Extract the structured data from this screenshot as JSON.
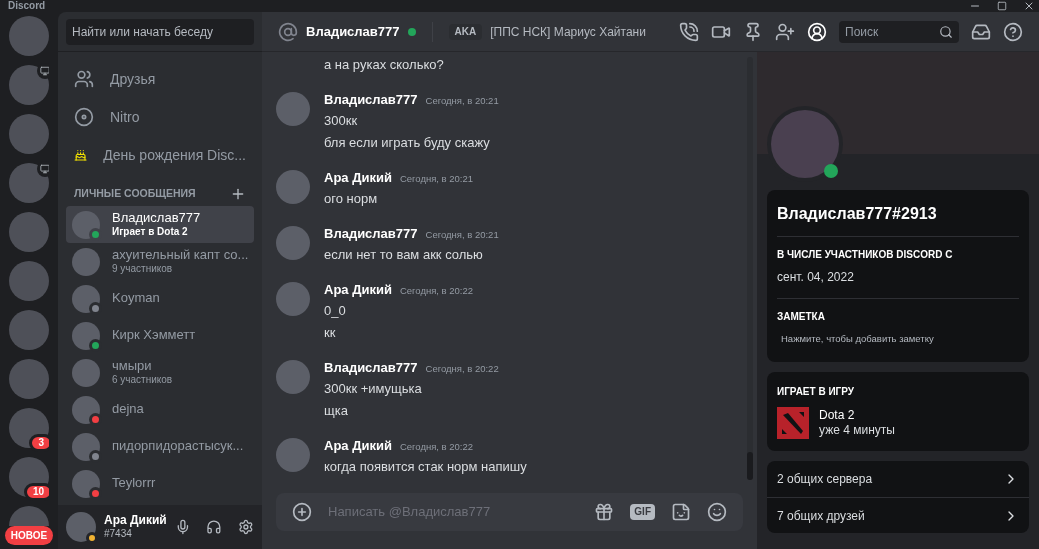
{
  "app_title": "Discord",
  "servers": [
    {
      "live": false
    },
    {
      "live": true
    },
    {
      "live": false
    },
    {
      "live": true
    },
    {
      "live": false
    },
    {
      "live": false
    },
    {
      "live": false
    },
    {
      "live": false
    },
    {
      "live": false,
      "badge": "3"
    },
    {
      "live": false,
      "badge": "10"
    },
    {
      "live": false
    }
  ],
  "new_badge": "НОВОЕ",
  "dm_search": {
    "placeholder": "Найти или начать беседу"
  },
  "nav": [
    {
      "kind": "friends",
      "label": "Друзья"
    },
    {
      "kind": "nitro",
      "label": "Nitro"
    },
    {
      "kind": "birthday",
      "label": "День рождения Disc..."
    }
  ],
  "dm_header": "ЛИЧНЫЕ СООБЩЕНИЯ",
  "dms": [
    {
      "name": "Владислав777",
      "sub": "Играет в Dota 2",
      "color": "#23a55a",
      "selected": true
    },
    {
      "name": "ахуительный капт со...",
      "sub": "9 участников",
      "selected": false
    },
    {
      "name": "Koyman",
      "color": "#80848e",
      "selected": false
    },
    {
      "name": "Кирк Хэмметт",
      "color": "#23a55a",
      "selected": false
    },
    {
      "name": "чмыри",
      "sub": "6 участников",
      "selected": false
    },
    {
      "name": "dejna",
      "color": "#f23f43",
      "selected": false
    },
    {
      "name": "пидорпидорастысук...",
      "color": "#80848e",
      "selected": false
    },
    {
      "name": "Teylorrr",
      "color": "#f23f43",
      "selected": false
    }
  ],
  "user": {
    "name": "Ара Дикий",
    "tag": "#7434",
    "color": "#f0b232"
  },
  "header": {
    "name": "Владислав777",
    "color": "#23a55a",
    "aka": "AKA",
    "alias": "[ППС НСК] Мариус Хайтани",
    "search_placeholder": "Поиск"
  },
  "messages": [
    {
      "lines": [
        "а на руках сколько?"
      ]
    },
    {
      "author": "Владислав777",
      "time": "Сегодня, в 20:21",
      "lines": [
        "300кк",
        "бля если играть буду скажу"
      ]
    },
    {
      "author": "Ара Дикий",
      "time": "Сегодня, в 20:21",
      "lines": [
        "ого норм"
      ]
    },
    {
      "author": "Владислав777",
      "time": "Сегодня, в 20:21",
      "lines": [
        "если нет то вам акк солью"
      ]
    },
    {
      "author": "Ара Дикий",
      "time": "Сегодня, в 20:22",
      "lines": [
        "0_0",
        "кк"
      ]
    },
    {
      "author": "Владислав777",
      "time": "Сегодня, в 20:22",
      "lines": [
        "300кк +имущька",
        "щка"
      ]
    },
    {
      "author": "Ара Дикий",
      "time": "Сегодня, в 20:22",
      "lines": [
        "когда появится стак норм напишу"
      ]
    }
  ],
  "composer": {
    "placeholder": "Написать @Владислав777",
    "gif": "GIF"
  },
  "profile": {
    "color": "#23a55a",
    "name": "Владислав777#2913",
    "member_title": "В ЧИСЛЕ УЧАСТНИКОВ DISCORD С",
    "member_since": "сент. 04, 2022",
    "note_title": "ЗАМЕТКА",
    "note_placeholder": "Нажмите, чтобы добавить заметку",
    "game_title": "ИГРАЕТ В ИГРУ",
    "game": "Dota 2",
    "game_time": "уже 4 минуты",
    "mutual": [
      "2 общих сервера",
      "7 общих друзей"
    ]
  }
}
